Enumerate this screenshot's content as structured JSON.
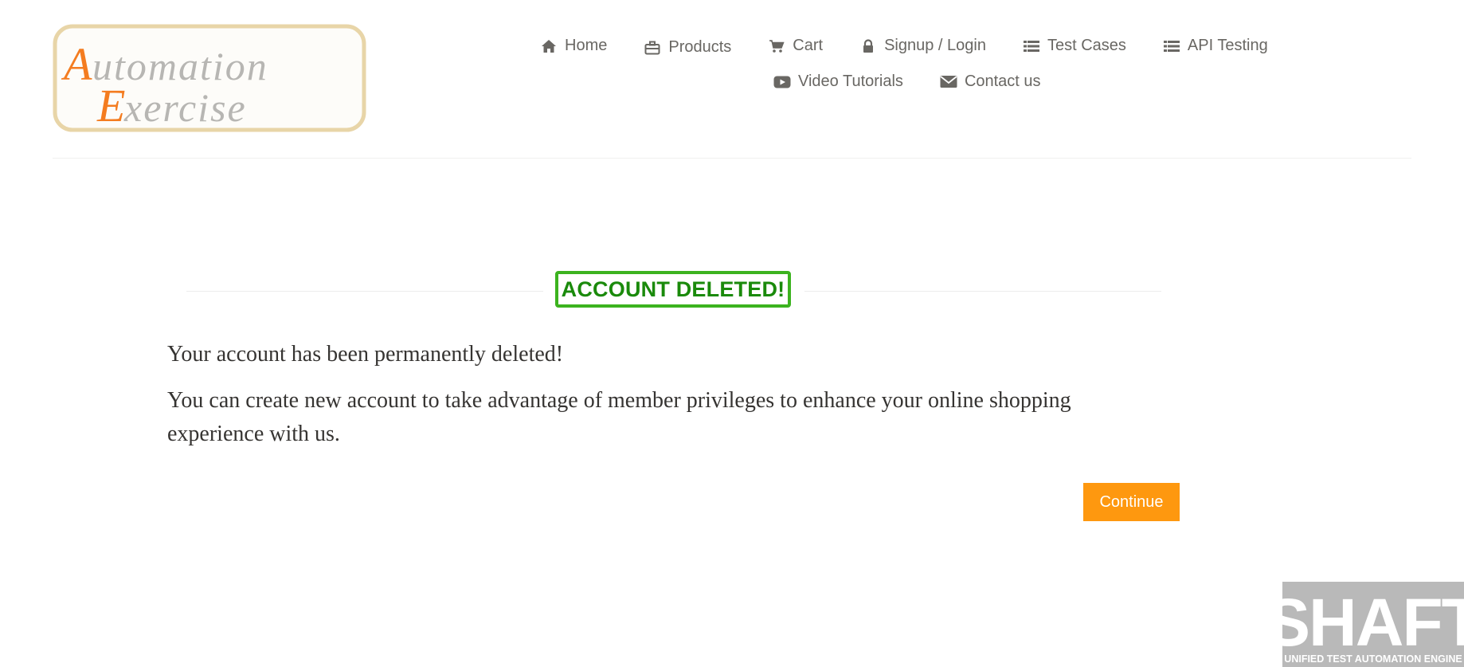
{
  "logo": {
    "line1": "Automation",
    "line2": "Exercise",
    "icon": "automation-exercise-logo"
  },
  "nav": {
    "row1": [
      {
        "label": "Home",
        "icon": "home-icon"
      },
      {
        "label": "Products",
        "icon": "briefcase-icon"
      },
      {
        "label": "Cart",
        "icon": "cart-icon"
      },
      {
        "label": "Signup / Login",
        "icon": "lock-icon"
      },
      {
        "label": "Test Cases",
        "icon": "list-icon"
      },
      {
        "label": "API Testing",
        "icon": "list-icon"
      }
    ],
    "row2": [
      {
        "label": "Video Tutorials",
        "icon": "youtube-play-icon"
      },
      {
        "label": "Contact us",
        "icon": "envelope-icon"
      }
    ]
  },
  "main": {
    "title": "ACCOUNT DELETED!",
    "message1": "Your account has been permanently deleted!",
    "message2": "You can create new account to take advantage of member privileges to enhance your online shopping experience with us.",
    "continue_label": "Continue"
  },
  "watermark": {
    "big": "SHAFT",
    "small": "UNIFIED TEST AUTOMATION ENGINE"
  },
  "colors": {
    "accent": "#fe980f",
    "title_green": "#1a8a0b",
    "title_border": "#3cb31f",
    "nav_text": "#696763",
    "logo_orange": "#f47c20",
    "logo_gray": "#b7b6b3",
    "logo_frame": "#e8d5a8"
  }
}
